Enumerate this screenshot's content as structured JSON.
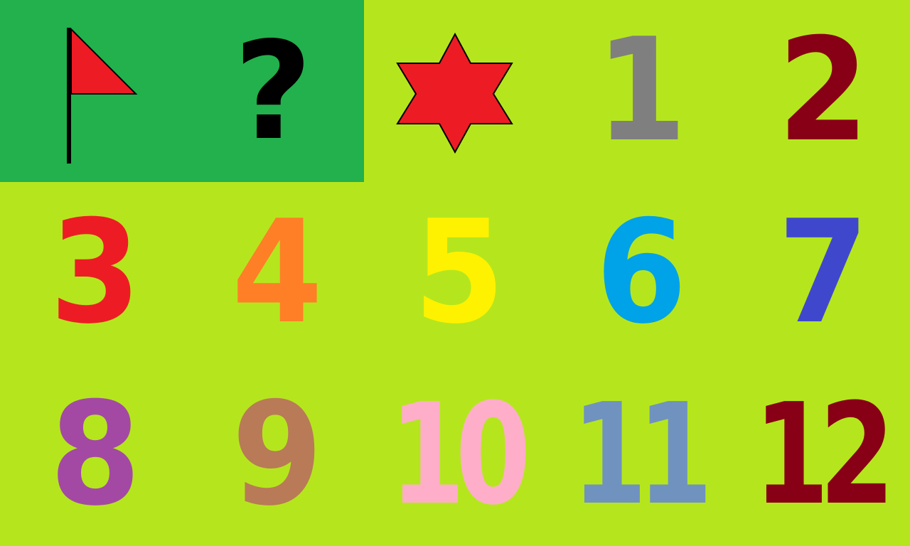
{
  "board": {
    "cells": [
      {
        "type": "flag",
        "icon": "flag-icon",
        "background": "#22b14c",
        "flag_color": "#ed1c24"
      },
      {
        "type": "unknown",
        "label": "?",
        "background": "#22b14c",
        "color": "#000000"
      },
      {
        "type": "mine",
        "icon": "star-icon",
        "background": "#b5e61d",
        "color": "#ed1c24"
      },
      {
        "type": "number",
        "label": "1",
        "color": "#7f7f7f"
      },
      {
        "type": "number",
        "label": "2",
        "color": "#880015"
      },
      {
        "type": "number",
        "label": "3",
        "color": "#ed1c24"
      },
      {
        "type": "number",
        "label": "4",
        "color": "#ff7f27"
      },
      {
        "type": "number",
        "label": "5",
        "color": "#fff200"
      },
      {
        "type": "number",
        "label": "6",
        "color": "#00a2e8"
      },
      {
        "type": "number",
        "label": "7",
        "color": "#3f48cc"
      },
      {
        "type": "number",
        "label": "8",
        "color": "#a349a4"
      },
      {
        "type": "number",
        "label": "9",
        "color": "#b97a57"
      },
      {
        "type": "number",
        "label": "10",
        "color": "#ffaec9"
      },
      {
        "type": "number",
        "label": "11",
        "color": "#7092be"
      },
      {
        "type": "number",
        "label": "12",
        "color": "#880015"
      }
    ],
    "colors": {
      "revealed": "#22b14c",
      "hidden": "#b5e61d"
    }
  }
}
